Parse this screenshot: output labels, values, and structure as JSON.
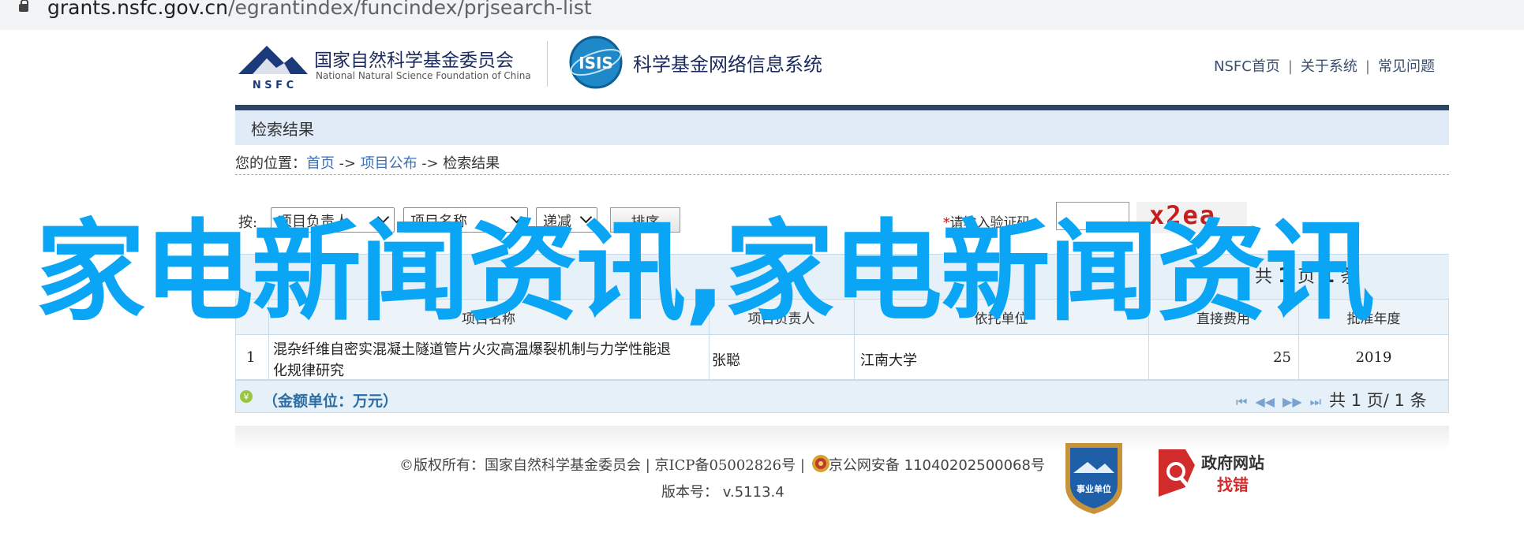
{
  "browser": {
    "url_host": "grants.nsfc.gov.cn",
    "url_path": "/egrantindex/funcindex/prjsearch-list"
  },
  "header": {
    "nsfc_logo_text": "N S F C",
    "nsfc_name_cn": "国家自然科学基金委员会",
    "nsfc_name_en": "National Natural Science Foundation of China",
    "isis_logo_text": "ISIS",
    "isis_title": "科学基金网络信息系统",
    "nav": [
      "NSFC首页",
      "关于系统",
      "常见问题"
    ],
    "nav_sep": "|"
  },
  "section": {
    "title": "检索结果"
  },
  "breadcrumb": {
    "prefix": "您的位置：",
    "home": "首页",
    "arrow": "->",
    "item1": "项目公布",
    "current": "检索结果"
  },
  "sort": {
    "label": "按:",
    "field1": "项目负责人",
    "field2": "项目名称",
    "order": "递减",
    "button": "排序",
    "captcha_required": "*",
    "captcha_label": "请输入验证码:",
    "captcha_text": "x2ea"
  },
  "pager": {
    "total_prefix": "共",
    "total_pages": "1",
    "page_unit": "页",
    "current_page": "1",
    "item_unit": "条"
  },
  "table": {
    "headers": [
      "项目名称",
      "项目负责人",
      "依托单位",
      "直接费用",
      "批准年度"
    ],
    "rows": [
      {
        "index": "1",
        "name_line1": "混杂纤维自密实混凝土隧道管片火灾高温爆裂机制与力学性能退",
        "name_line2": "化规律研究",
        "leader": "张聪",
        "institution": "江南大学",
        "cost": "25",
        "year": "2019"
      }
    ]
  },
  "unit_label": "（金额单位：万元）",
  "footer": {
    "copyright": "©版权所有：国家自然科学基金委员会 | 京ICP备05002826号 |",
    "police": "京公网安备 11040202500068号",
    "version_label": "版本号：",
    "version": "v.5113.4",
    "badge_shiye": "事业单位",
    "badge_gov_line1": "政府网站",
    "badge_gov_line2": "找错"
  },
  "overlay_text": "家电新闻资讯,家电新闻资讯",
  "colors": {
    "navbar": "#2d4469",
    "overlay": "#0aa6f5",
    "link": "#3b6fb6"
  }
}
